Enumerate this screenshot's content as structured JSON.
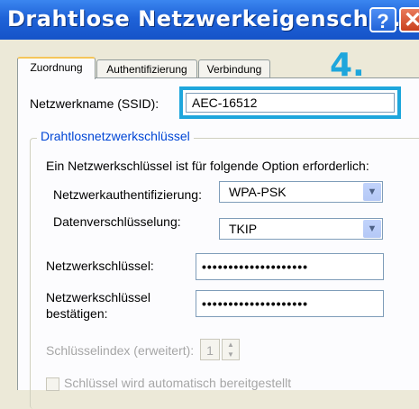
{
  "window": {
    "title": "Drahtlose Netzwerkeigenschaf...",
    "help_label": "?",
    "close_label": "✕"
  },
  "tabs": [
    {
      "label": "Zuordnung"
    },
    {
      "label": "Authentifizierung"
    },
    {
      "label": "Verbindung"
    }
  ],
  "step_label": "4.",
  "ssid": {
    "label": "Netzwerkname (SSID):",
    "value": "AEC-16512"
  },
  "wireless_key": {
    "group_title": "Drahtlosnetzwerkschlüssel",
    "info": "Ein Netzwerkschlüssel ist für folgende Option erforderlich:",
    "auth_label": "Netzwerkauthentifizierung:",
    "auth_value": "WPA-PSK",
    "encryption_label": "Datenverschlüsselung:",
    "encryption_value": "TKIP",
    "key_label": "Netzwerkschlüssel:",
    "key_value": "••••••••••••••••••••",
    "confirm_label_line1": "Netzwerkschlüssel",
    "confirm_label_line2": "bestätigen:",
    "confirm_value": "••••••••••••••••••••",
    "key_index_label": "Schlüsselindex (erweitert):",
    "key_index_value": "1",
    "auto_key_label": "Schlüssel wird automatisch bereitgestellt"
  },
  "icons": {
    "dropdown_arrow": "chevron-down-icon",
    "spinner": "spinner-arrows-icon"
  }
}
